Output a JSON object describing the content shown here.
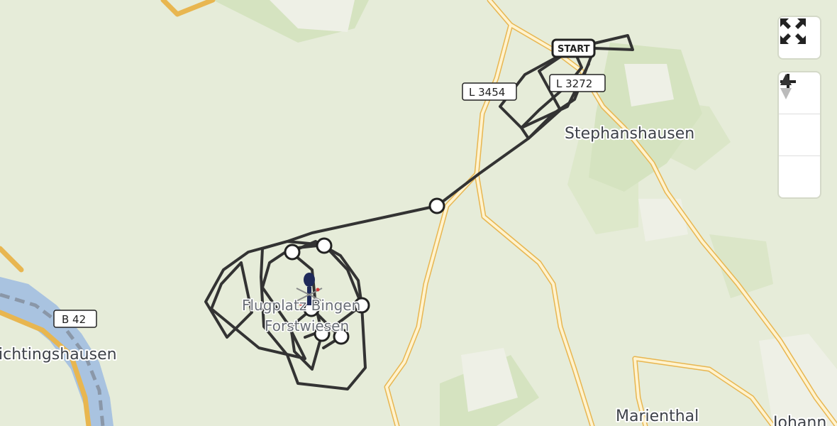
{
  "map": {
    "places": [
      {
        "id": "stephanshausen",
        "label": "Stephanshausen"
      },
      {
        "id": "marienthal",
        "label": "Marienthal"
      },
      {
        "id": "aulhausen",
        "label": "ichtingshausen"
      },
      {
        "id": "johannisberg",
        "label": "Johann"
      }
    ],
    "airfield_label_line1": "Flugplatz Bingen",
    "airfield_label_line2": "Forstwiesen",
    "roads": [
      {
        "id": "l3454",
        "label": "L 3454"
      },
      {
        "id": "l3272",
        "label": "L 3272"
      },
      {
        "id": "b42",
        "label": "B 42"
      }
    ],
    "route": {
      "start_label": "START",
      "color": "#333333"
    },
    "colors": {
      "land": "#e6ecd9",
      "forest": "#d5e3bf",
      "water": "#a9c3e0",
      "road_major": "#f7c96a",
      "road_minor": "#ffffff"
    }
  },
  "controls": {
    "fullscreen": {
      "icon": "fullscreen-icon"
    },
    "zoom_in": {
      "icon": "plus-icon"
    },
    "zoom_out": {
      "icon": "minus-icon"
    },
    "reset_north": {
      "icon": "compass-icon"
    }
  }
}
